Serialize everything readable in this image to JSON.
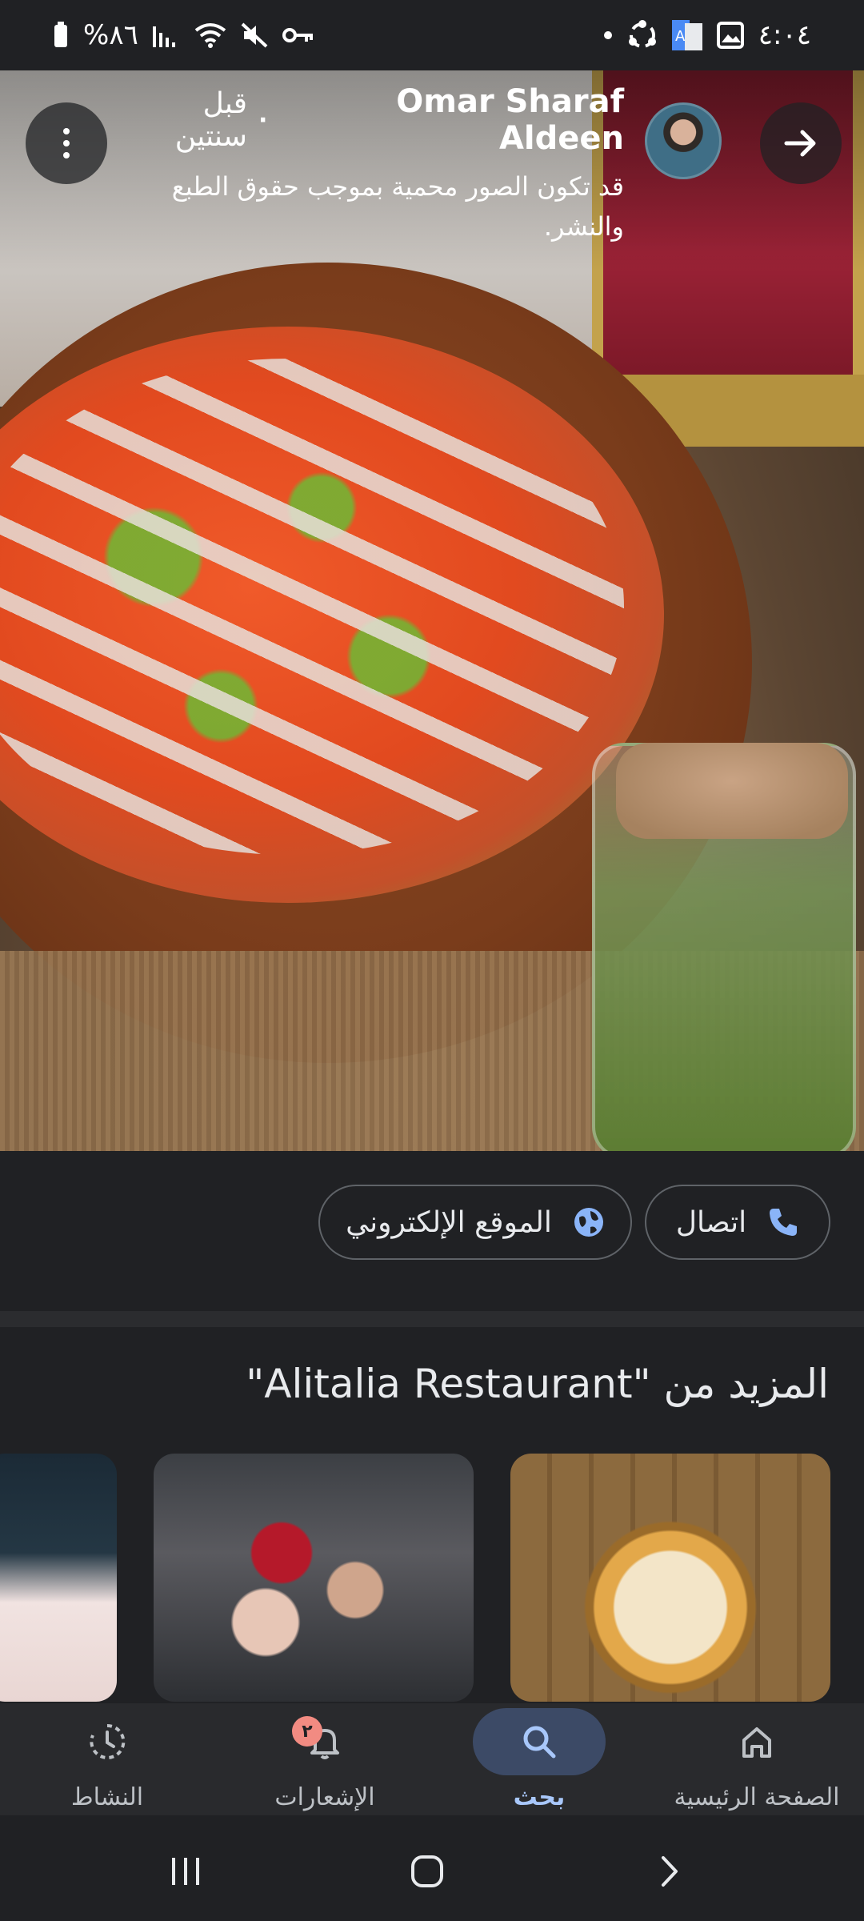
{
  "status_bar": {
    "time": "٤:٠٤",
    "battery_percent": "%٨٦"
  },
  "photo": {
    "author": "Omar Sharaf Aldeen",
    "time_ago": "قبل سنتين",
    "separator": "·",
    "copyright_notice": "قد تكون الصور محمية بموجب حقوق الطبع والنشر."
  },
  "actions": {
    "call_label": "اتصال",
    "website_label": "الموقع الإلكتروني"
  },
  "more": {
    "title": "المزيد من \"Alitalia Restaurant\""
  },
  "bottom_nav": {
    "home_label": "الصفحة الرئيسية",
    "search_label": "بحث",
    "notifications_label": "الإشعارات",
    "notifications_badge": "٢",
    "activity_label": "النشاط"
  },
  "colors": {
    "background": "#202124",
    "accent": "#a8c7fa",
    "active_pill": "#3c4a66",
    "icon_blue": "#8ab4f8",
    "badge": "#f28b82"
  }
}
